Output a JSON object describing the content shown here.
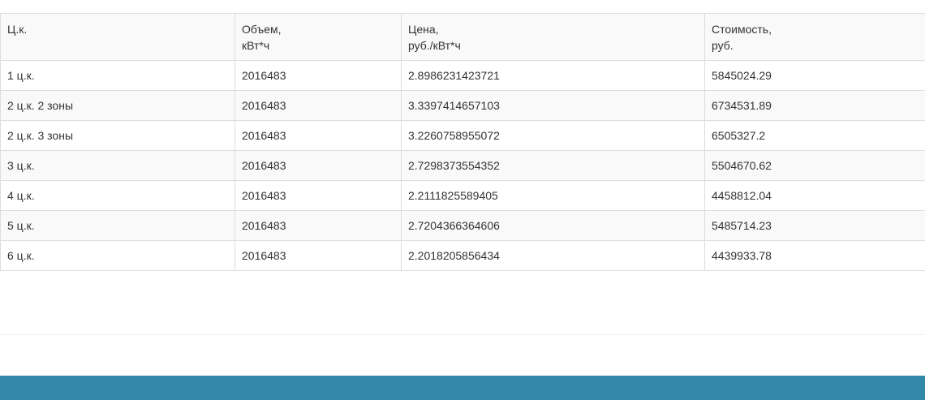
{
  "table": {
    "headers": [
      {
        "line1": "Ц.к.",
        "line2": ""
      },
      {
        "line1": "Объем,",
        "line2": "кВт*ч"
      },
      {
        "line1": "Цена,",
        "line2": "руб./кВт*ч"
      },
      {
        "line1": "Стоимость,",
        "line2": "руб."
      }
    ],
    "rows": [
      [
        "1 ц.к.",
        "2016483",
        "2.8986231423721",
        "5845024.29"
      ],
      [
        "2 ц.к. 2 зоны",
        "2016483",
        "3.3397414657103",
        "6734531.89"
      ],
      [
        "2 ц.к. 3 зоны",
        "2016483",
        "3.2260758955072",
        "6505327.2"
      ],
      [
        "3 ц.к.",
        "2016483",
        "2.7298373554352",
        "5504670.62"
      ],
      [
        "4 ц.к.",
        "2016483",
        "2.2111825589405",
        "4458812.04"
      ],
      [
        "5 ц.к.",
        "2016483",
        "2.7204366364606",
        "5485714.23"
      ],
      [
        "6 ц.к.",
        "2016483",
        "2.2018205856434",
        "4439933.78"
      ]
    ]
  },
  "colors": {
    "footer": "#3288a8",
    "stripe": "#f9f9f9",
    "border": "#dddddd"
  }
}
